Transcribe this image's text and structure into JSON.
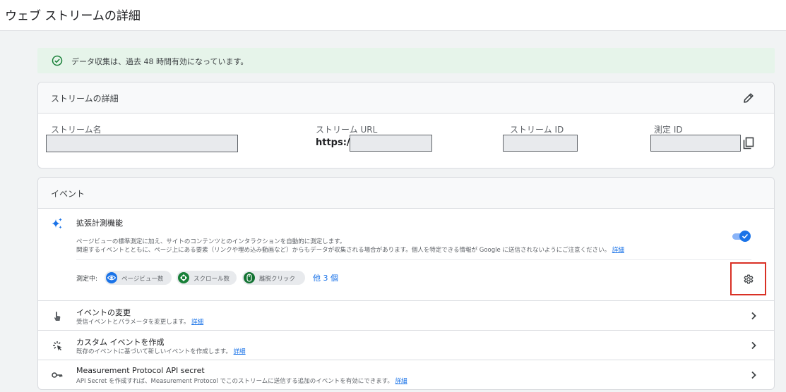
{
  "header": {
    "title": "ウェブ ストリームの詳細"
  },
  "alert": {
    "text": "データ収集は、過去 48 時間有効になっています。"
  },
  "details": {
    "title": "ストリームの詳細",
    "stream_name_label": "ストリーム名",
    "stream_url_label": "ストリーム URL",
    "url_prefix": "https://",
    "stream_id_label": "ストリーム ID",
    "measurement_id_label": "測定 ID"
  },
  "events": {
    "title": "イベント",
    "enhanced": {
      "title": "拡張計測機能",
      "desc_line1": "ページビューの標準測定に加え、サイトのコンテンツとのインタラクションを自動的に測定します。",
      "desc_line2": "関連するイベントとともに、ページ上にある要素（リンクや埋め込み動画など）からもデータが収集される場合があります。個人を特定できる情報が Google に送信されないようにご注意ください。",
      "learn_more": "詳細",
      "enabled": true,
      "measuring_label": "測定中:",
      "chips": [
        "ページビュー数",
        "スクロール数",
        "離脱クリック"
      ],
      "more": "他 3 個"
    },
    "rows": [
      {
        "title": "イベントの変更",
        "subtitle": "受信イベントとパラメータを変更します。",
        "link": "詳細"
      },
      {
        "title": "カスタム イベントを作成",
        "subtitle": "既存のイベントに基づいて新しいイベントを作成します。",
        "link": "詳細"
      },
      {
        "title": "Measurement Protocol API secret",
        "subtitle": "API Secret を作成すれば、Measurement Protocol でこのストリームに送信する追加のイベントを有効にできます。",
        "link": "詳細"
      }
    ]
  },
  "colors": {
    "accent": "#1a73e8",
    "success": "#188038",
    "highlight_border": "#d93025"
  }
}
